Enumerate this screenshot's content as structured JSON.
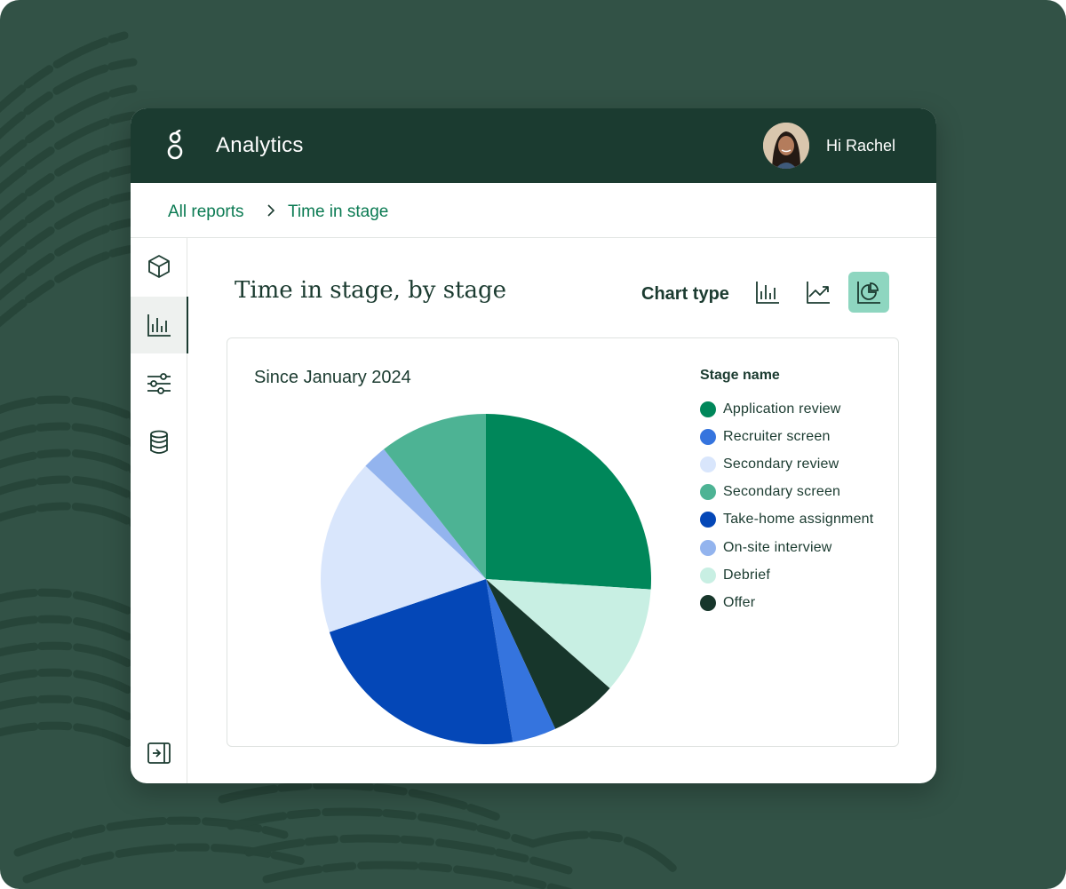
{
  "app": {
    "title": "Analytics",
    "greeting": "Hi Rachel"
  },
  "breadcrumb": {
    "items": [
      "All reports",
      "Time in stage"
    ]
  },
  "sidebar": {
    "items": [
      {
        "icon": "cube-icon",
        "active": false
      },
      {
        "icon": "bar-chart-icon",
        "active": true
      },
      {
        "icon": "sliders-icon",
        "active": false
      },
      {
        "icon": "database-icon",
        "active": false
      },
      {
        "icon": "expand-sidebar-icon",
        "active": false
      }
    ]
  },
  "main": {
    "title": "Time in stage, by stage",
    "chart_type_label": "Chart type",
    "chart_types": [
      {
        "icon": "bar-chart-icon",
        "active": false
      },
      {
        "icon": "line-chart-icon",
        "active": false
      },
      {
        "icon": "pie-chart-icon",
        "active": true
      }
    ]
  },
  "chart_data": {
    "type": "pie",
    "title": "",
    "subtitle": "Since January 2024",
    "legend_title": "Stage name",
    "legend_position": "right",
    "start_angle_deg": 0,
    "direction": "clockwise",
    "slices": [
      {
        "label": "Application review",
        "value": 26.0,
        "color": "#00875A"
      },
      {
        "label": "Debrief",
        "value": 10.5,
        "color": "#C8EFE3"
      },
      {
        "label": "Offer",
        "value": 6.6,
        "color": "#17362B"
      },
      {
        "label": "Recruiter screen",
        "value": 4.3,
        "color": "#3574DE"
      },
      {
        "label": "Take-home assignment",
        "value": 22.4,
        "color": "#0447B7"
      },
      {
        "label": "Secondary review",
        "value": 17.2,
        "color": "#D9E6FC"
      },
      {
        "label": "On-site interview",
        "value": 2.4,
        "color": "#93B4EE"
      },
      {
        "label": "Secondary screen",
        "value": 10.6,
        "color": "#4DB394"
      }
    ],
    "legend_order": [
      "Application review",
      "Recruiter screen",
      "Secondary review",
      "Secondary screen",
      "Take-home assignment",
      "On-site interview",
      "Debrief",
      "Offer"
    ]
  },
  "colors": {
    "background": "#325246",
    "header": "#1B3B30",
    "accent": "#0A7A52",
    "active_chart_button": "#8ED6C0"
  }
}
